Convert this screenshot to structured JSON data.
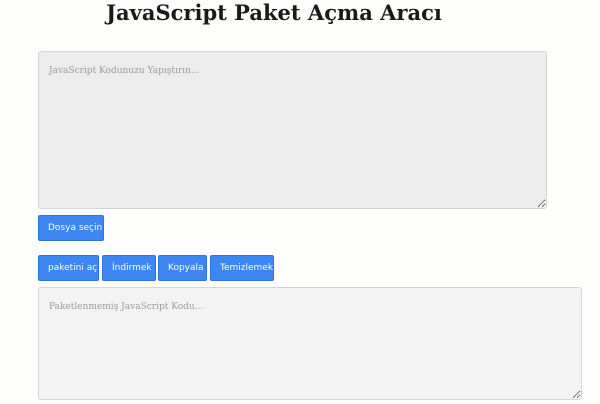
{
  "header": {
    "title": "JavaScript Paket Açma Aracı"
  },
  "input": {
    "placeholder": "JavaScript Kodunuzu Yapıştırın...",
    "value": ""
  },
  "file": {
    "choose_label": "Dosya seçin"
  },
  "actions": {
    "unpack_label": "paketini aç",
    "download_label": "İndirmek",
    "copy_label": "Kopyala",
    "clear_label": "Temizlemek"
  },
  "output": {
    "placeholder": "Paketlenmemiş JavaScript Kodu...",
    "value": ""
  },
  "colors": {
    "button_bg": "#3d86f2",
    "button_text": "#ffffff",
    "input_bg": "#ececec",
    "output_bg": "#f3f3f3"
  }
}
